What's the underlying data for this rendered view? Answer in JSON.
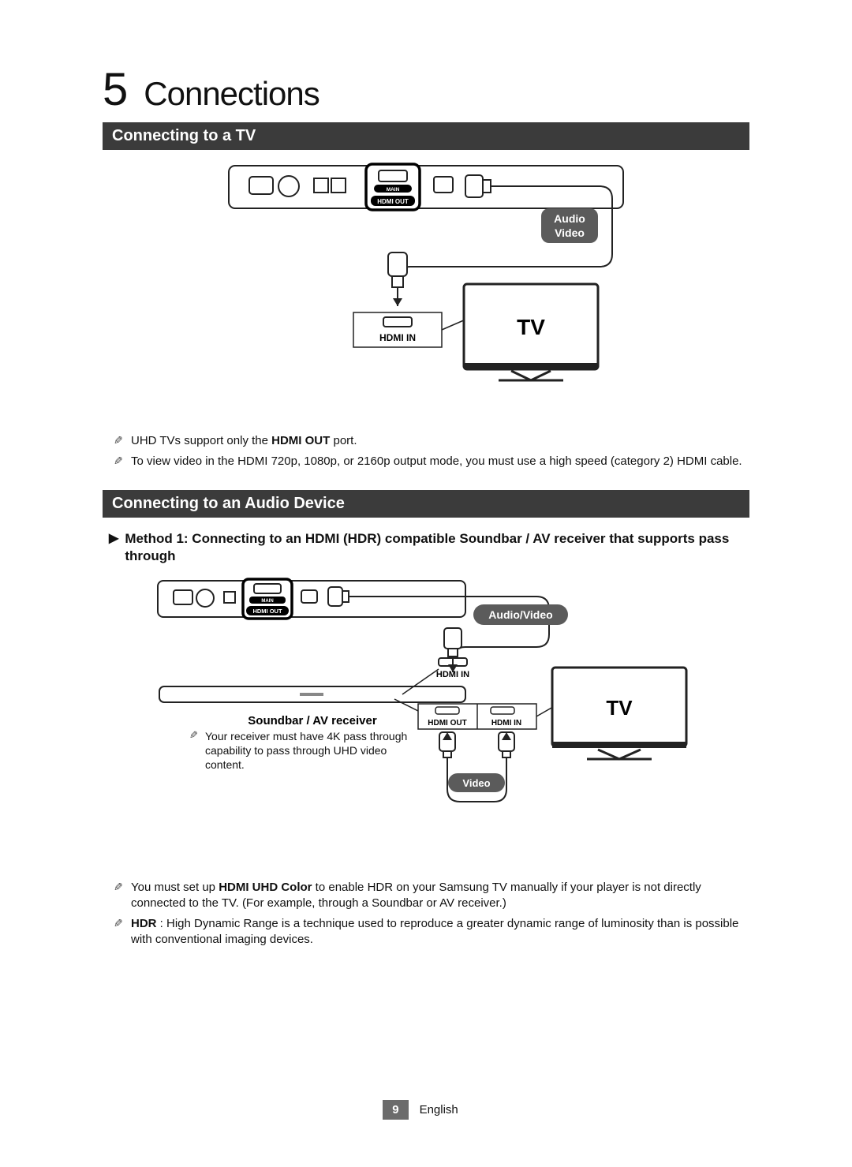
{
  "chapter": {
    "number": "5",
    "title": "Connections"
  },
  "section1": {
    "title": "Connecting to a TV",
    "diagram": {
      "hdmi_out_sub": "MAIN",
      "hdmi_out": "HDMI OUT",
      "audio": "Audio",
      "video": "Video",
      "hdmi_in": "HDMI IN",
      "tv": "TV"
    },
    "notes": [
      {
        "pre": "UHD TVs support only the ",
        "bold": "HDMI OUT",
        "post": " port."
      },
      {
        "pre": "To view video in the HDMI 720p, 1080p, or 2160p output mode, you must use a high speed (category 2) HDMI cable.",
        "bold": "",
        "post": ""
      }
    ]
  },
  "section2": {
    "title": "Connecting to an Audio Device",
    "method_arrow": "▶",
    "method_title": "Method 1: Connecting to an HDMI (HDR) compatible Soundbar / AV receiver that supports pass through",
    "diagram": {
      "hdmi_out_sub": "MAIN",
      "hdmi_out": "HDMI OUT",
      "audio_video": "Audio/Video",
      "hdmi_in_top": "HDMI IN",
      "hdmi_out_bot": "HDMI OUT",
      "hdmi_in_bot": "HDMI IN",
      "video": "Video",
      "soundbar_label": "Soundbar / AV receiver",
      "tv": "TV"
    },
    "receiver_note": "Your receiver must have 4K pass through capability to pass through UHD video content.",
    "notes": [
      {
        "pre": "You must set up ",
        "bold": "HDMI UHD Color",
        "post": " to enable HDR on your Samsung TV manually if your player is not directly connected to the TV. (For example, through a Soundbar or AV receiver.)"
      },
      {
        "pre": "",
        "bold": "HDR",
        "post": " : High Dynamic Range is a technique used to reproduce a greater dynamic range of luminosity than is possible with conventional imaging devices."
      }
    ]
  },
  "footer": {
    "page": "9",
    "language": "English"
  }
}
